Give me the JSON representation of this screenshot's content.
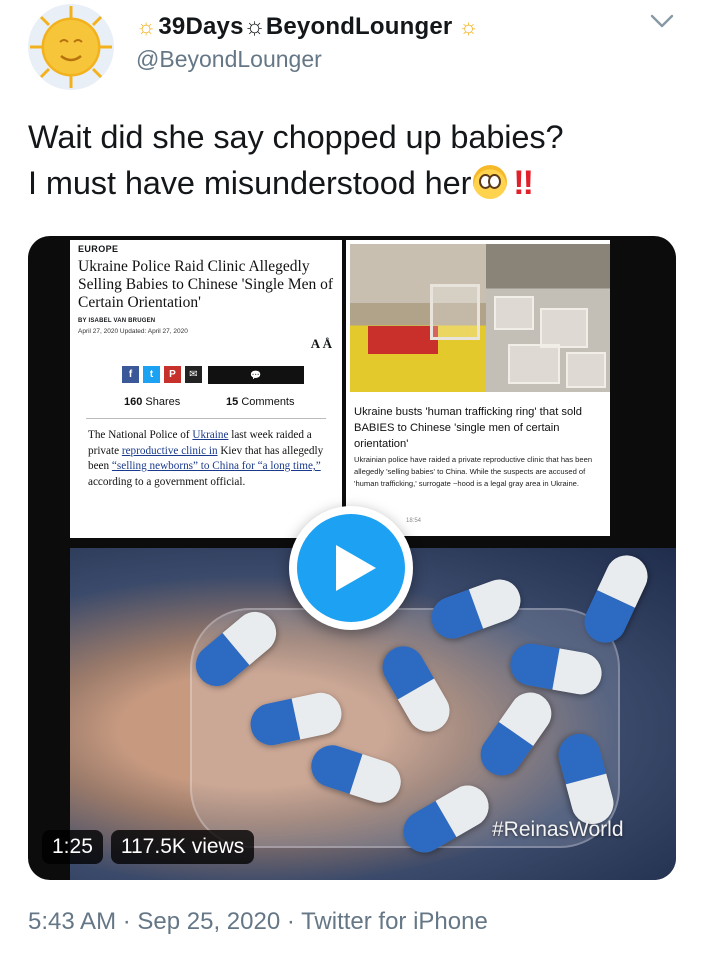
{
  "tweet": {
    "display_name": "39Days☼BeyondLounger",
    "name_prefix_icon": "sun-icon",
    "name_suffix_icon": "sun-icon",
    "handle": "@BeyondLounger",
    "text_line1": "Wait did she say chopped up babies?",
    "text_line2": "I must have misunderstood her",
    "text_emojis": [
      "flushed-face-emoji",
      "double-exclamation-emoji"
    ],
    "menu_icon": "chevron-down-icon",
    "footer": "5:43 AM · Sep 25, 2020 · Twitter for iPhone"
  },
  "media": {
    "article": {
      "section": "EUROPE",
      "title": "Ukraine Police Raid Clinic Allegedly Selling Babies to Chinese 'Single Men of Certain Orientation'",
      "byline": "BY ISABEL VAN BRUGEN",
      "date": "April 27, 2020  Updated: April 27, 2020",
      "text_size_label": "A Å",
      "share_icons": [
        "facebook-icon",
        "twitter-icon",
        "parler-icon",
        "email-icon"
      ],
      "shares_count": "160",
      "shares_label": "Shares",
      "comments_count": "15",
      "comments_label": "Comments",
      "body_a": "The National Police of ",
      "body_link1": "Ukraine",
      "body_b": " last week raided a private ",
      "body_link2": "reproductive clinic in",
      "body_c": " Kiev that has allegedly been ",
      "body_link3": "“selling newborns” to China for “a long time,”",
      "body_d": " according to a government official."
    },
    "news_card": {
      "headline": "Ukraine busts 'human trafficking ring' that sold BABIES to Chinese 'single men of certain orientation'",
      "body": "Ukrainian police have raided a private reproductive clinic that has been allegedly 'selling babies' to China. While the suspects are accused of 'human trafficking,' surrogate ~hood is a legal gray area in Ukraine.",
      "time": "18:54"
    },
    "watermark": "#ReinasWorld",
    "duration": "1:25",
    "views": "117.5K views",
    "play_icon": "play-icon",
    "colors": {
      "play_button": "#1da1f2",
      "pill_blue": "#2d6bc2",
      "pill_white": "#e9ecef"
    }
  }
}
